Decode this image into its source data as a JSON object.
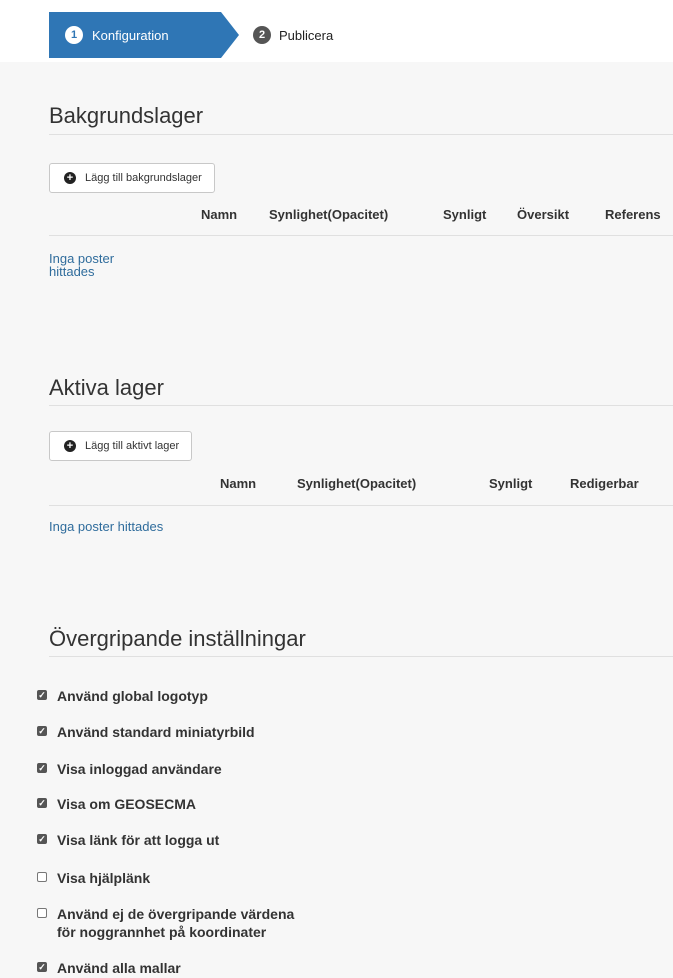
{
  "steps": [
    {
      "num": "1",
      "label": "Konfiguration"
    },
    {
      "num": "2",
      "label": "Publicera"
    }
  ],
  "background_layers": {
    "title": "Bakgrundslager",
    "add_button": "Lägg till bakgrundslager",
    "columns": [
      "Namn",
      "Synlighet(Opacitet)",
      "Synligt",
      "Översikt",
      "Referens"
    ],
    "empty_line1": "Inga poster",
    "empty_line2": "hittades"
  },
  "active_layers": {
    "title": "Aktiva lager",
    "add_button": "Lägg till aktivt lager",
    "columns": [
      "Namn",
      "Synlighet(Opacitet)",
      "Synligt",
      "Redigerbar"
    ],
    "empty": "Inga poster hittades"
  },
  "settings": {
    "title": "Övergripande inställningar",
    "options": [
      {
        "label": "Använd global logotyp",
        "checked": true
      },
      {
        "label": "Använd standard miniatyrbild",
        "checked": true
      },
      {
        "label": "Visa inloggad användare",
        "checked": true
      },
      {
        "label": "Visa om GEOSECMA",
        "checked": true
      },
      {
        "label": "Visa länk för att logga ut",
        "checked": true
      },
      {
        "label": "Visa hjälplänk",
        "checked": false
      },
      {
        "label": "Använd ej de övergripande värdena",
        "label2": "för noggrannhet på koordinater",
        "checked": false
      },
      {
        "label": "Använd alla mallar",
        "checked": true
      }
    ]
  },
  "colors": {
    "accent": "#2f76b5",
    "link": "#2f6c9c",
    "background": "#f7f7f7"
  }
}
